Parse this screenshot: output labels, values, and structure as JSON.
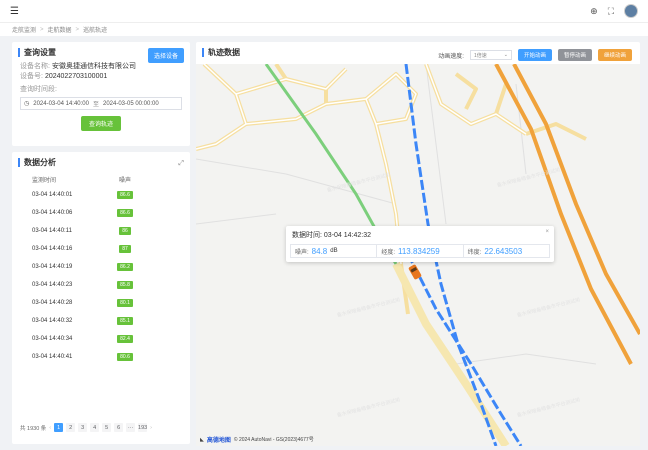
{
  "topbar": {
    "menu_icon": "hamburger-icon",
    "icons": [
      "globe-icon",
      "fullscreen-icon",
      "avatar"
    ]
  },
  "breadcrumb": [
    "走航监测",
    "走航数据",
    "巡航轨迹"
  ],
  "query_panel": {
    "title": "查询设置",
    "select_button": "选择设备",
    "device_name_label": "设备名称:",
    "device_name": "安徽奥捷通信科技有限公司",
    "device_no_label": "设备号:",
    "device_no": "2024022703100001",
    "time_label": "查询时间段:",
    "start_time": "2024-03-04 14:40:00",
    "range_sep": "至",
    "end_time": "2024-03-05 00:00:00",
    "query_button": "查询轨迹"
  },
  "analysis_panel": {
    "title": "数据分析",
    "columns": [
      "监测时间",
      "噪声"
    ],
    "rows": [
      {
        "time": "03-04 14:40:01",
        "value": "86.6"
      },
      {
        "time": "03-04 14:40:06",
        "value": "86.6"
      },
      {
        "time": "03-04 14:40:11",
        "value": "86"
      },
      {
        "time": "03-04 14:40:16",
        "value": "87"
      },
      {
        "time": "03-04 14:40:19",
        "value": "86.2"
      },
      {
        "time": "03-04 14:40:23",
        "value": "85.8"
      },
      {
        "time": "03-04 14:40:28",
        "value": "80.1"
      },
      {
        "time": "03-04 14:40:32",
        "value": "85.1"
      },
      {
        "time": "03-04 14:40:34",
        "value": "82.4"
      },
      {
        "time": "03-04 14:40:41",
        "value": "80.6"
      }
    ],
    "pager": {
      "total": "共 1930 条",
      "pages": [
        "1",
        "2",
        "3",
        "4",
        "5",
        "6",
        "···",
        "193"
      ],
      "active": "1"
    }
  },
  "map_panel": {
    "title": "轨迹数据",
    "speed_label": "动画速度:",
    "speed_value": "1倍速",
    "start_button": "开始动画",
    "pause_button": "暂停动画",
    "resume_button": "继续动画",
    "popup": {
      "time_label": "数据时间:",
      "time": "03-04 14:42:32",
      "noise_label": "噪声:",
      "noise": "84.8",
      "noise_unit": "dB",
      "lng_label": "经度:",
      "lng": "113.834259",
      "lat_label": "纬度:",
      "lat": "22.643503"
    },
    "map_logo": "高德地图",
    "copyright": "© 2024 AutoNavi - GS(2023)4677号"
  },
  "colors": {
    "accent": "#409eff",
    "tag": "#67c23a",
    "road_orange": "#f0a23b",
    "track_blue": "#3c86f7"
  }
}
